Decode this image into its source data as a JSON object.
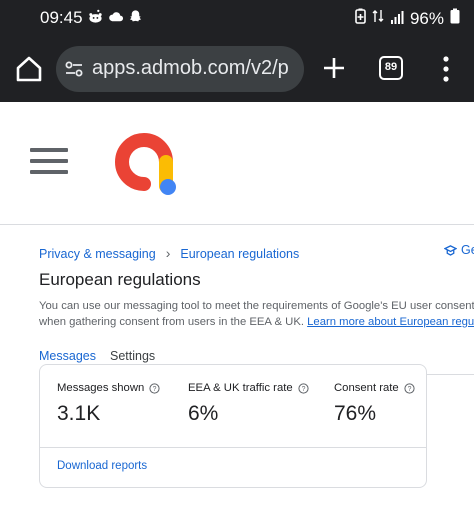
{
  "status_bar": {
    "time": "09:45",
    "battery": "96%"
  },
  "browser": {
    "url": "apps.admob.com/v2/p",
    "tab_count": "89"
  },
  "breadcrumb": {
    "parent": "Privacy & messaging",
    "current": "European regulations"
  },
  "help_link": "Ge",
  "page": {
    "title": "European regulations",
    "description_line1": "You can use our messaging tool to meet the requirements of Google's EU user consent policy",
    "description_line2": "when gathering consent from users in the EEA & UK.",
    "learn_more": "Learn more about European regulations"
  },
  "tabs": [
    {
      "label": "Messages",
      "active": true
    },
    {
      "label": "Settings",
      "active": false
    }
  ],
  "metrics": [
    {
      "label": "Messages shown",
      "value": "3.1K"
    },
    {
      "label": "EEA & UK traffic rate",
      "value": "6%"
    },
    {
      "label": "Consent rate",
      "value": "76%"
    }
  ],
  "download_reports": "Download reports",
  "colors": {
    "accent": "#1967d2",
    "browser_chrome": "#202124",
    "logo_red": "#ea4335",
    "logo_yellow": "#fbbc04",
    "logo_blue": "#4285f4"
  }
}
